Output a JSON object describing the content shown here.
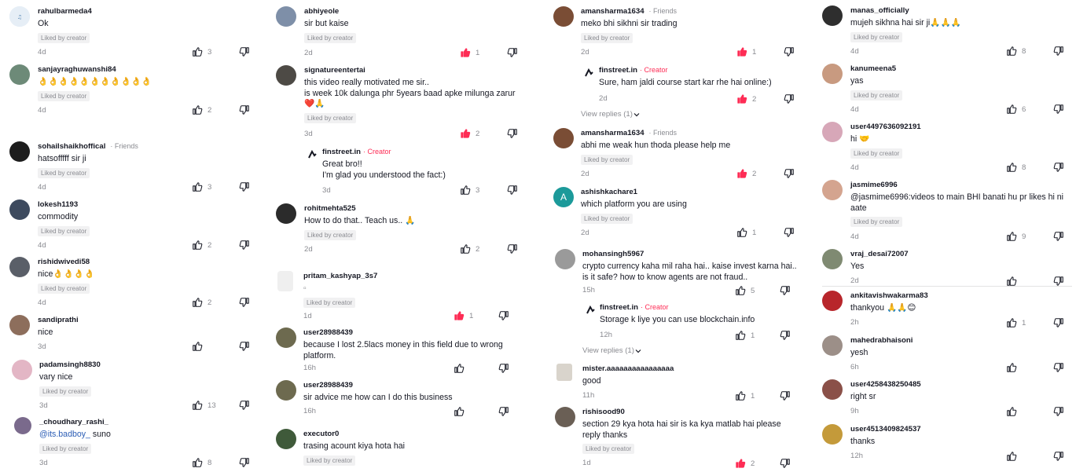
{
  "columns": [
    {
      "comments": [
        {
          "user": "rahulbarmeda4",
          "text": "Ok",
          "liked": "Liked by creator",
          "time": "4d",
          "likes": "3",
          "liked_by_me": false,
          "avatar_color": "#d8e4ef"
        },
        {
          "user": "sanjayraghuwanshi84",
          "text": "👌👌👌👌👌👌👌👌👌👌👌",
          "liked": "Liked by creator",
          "time": "4d",
          "likes": "2",
          "liked_by_me": false,
          "avatar_color": "#6d8a78"
        },
        {
          "user": "sohailshaikhoffical",
          "tag": "· Friends",
          "text": "hatsofffff sir ji",
          "liked": "Liked by creator",
          "time": "4d",
          "likes": "3",
          "liked_by_me": false,
          "avatar_color": "#1d1d1d"
        },
        {
          "user": "lokesh1193",
          "text": "commodity",
          "liked": "Liked by creator",
          "time": "4d",
          "likes": "2",
          "liked_by_me": false,
          "avatar_color": "#3d4a5e"
        },
        {
          "user": "rishidwivedi58",
          "text": "nice👌👌👌👌",
          "liked": "Liked by creator",
          "time": "4d",
          "likes": "2",
          "liked_by_me": false,
          "avatar_color": "#5a5f68"
        },
        {
          "user": "sandiprathi",
          "text": "nice",
          "time": "3d",
          "likes": "",
          "liked_by_me": false,
          "avatar_color": "#8d6e5c"
        },
        {
          "user": "padamsingh8830",
          "text": "vary nice",
          "liked": "Liked by creator",
          "time": "3d",
          "likes": "13",
          "liked_by_me": false,
          "avatar_color": "#e3b6c5"
        },
        {
          "user": "_choudhary_rashi_",
          "text": "@its.badboy_ suno",
          "mention": "@its.badboy_",
          "rest": " suno",
          "liked": "Liked by creator",
          "time": "3d",
          "likes": "8",
          "liked_by_me": false,
          "avatar_color": "#7a6a8c"
        }
      ]
    },
    {
      "comments": [
        {
          "user": "abhiyeole",
          "text": "sir but kaise",
          "liked": "Liked by creator",
          "time": "2d",
          "likes": "1",
          "liked_by_me": true,
          "avatar_color": "#7e8fa8"
        },
        {
          "user": "signatureentertai",
          "text": "this video really motivated me sir..\nis week 10k dalunga phr 5years baad apke milunga zarur\n❤️🙏",
          "liked": "Liked by creator",
          "time": "3d",
          "likes": "2",
          "liked_by_me": true,
          "avatar_color": "#4d4a45"
        },
        {
          "user": "finstreet.in",
          "tag": "· Creator",
          "text": "Great bro!!\nI'm glad you understood the fact:)",
          "time": "3d",
          "likes": "3",
          "liked_by_me": false,
          "avatar_color": "#ffffff"
        },
        {
          "user": "rohitmehta525",
          "text": "How to do that.. Teach us.. 🙏",
          "liked": "Liked by creator",
          "time": "2d",
          "likes": "2",
          "liked_by_me": false,
          "avatar_color": "#2b2b2b"
        },
        {
          "user": "pritam_kashyap_3s7",
          "text": "▫",
          "liked": "Liked by creator",
          "time": "1d",
          "likes": "1",
          "liked_by_me": true,
          "avatar_color": "#efefef"
        },
        {
          "user": "user28988439",
          "text": "because I lost 2.5lacs money in this field due to wrong platform.",
          "time": "16h",
          "likes": "",
          "liked_by_me": false,
          "avatar_color": "#6d6a4f"
        },
        {
          "user": "user28988439",
          "text": "sir advice me how can I do this business",
          "time": "16h",
          "likes": "",
          "liked_by_me": false,
          "avatar_color": "#6d6a4f"
        },
        {
          "user": "executor0",
          "text": "trasing acount kiya hota hai",
          "liked": "Liked by creator",
          "time": "",
          "likes": "",
          "liked_by_me": false,
          "avatar_color": "#3f5a3a"
        }
      ]
    },
    {
      "comments": [
        {
          "user": "amansharma1634",
          "tag": "· Friends",
          "text": "meko bhi sikhni sir trading",
          "liked": "Liked by creator",
          "time": "2d",
          "likes": "1",
          "liked_by_me": true,
          "avatar_color": "#7a4d35"
        },
        {
          "user": "finstreet.in",
          "tag": "· Creator",
          "text": "Sure, ham jaldi course start kar rhe hai online:)",
          "time": "2d",
          "likes": "2",
          "liked_by_me": true,
          "avatar_color": "#ffffff"
        },
        {
          "user": "amansharma1634",
          "tag": "· Friends",
          "text": "abhi me weak hun thoda please help me",
          "liked": "Liked by creator",
          "time": "2d",
          "likes": "2",
          "liked_by_me": true,
          "avatar_color": "#7a4d35"
        },
        {
          "user": "ashishkachare1",
          "text": "which platform you are using",
          "liked": "Liked by creator",
          "time": "2d",
          "likes": "1",
          "liked_by_me": false,
          "avatar_color": "#1c9a9a",
          "initial": "A"
        },
        {
          "user": "mohansingh5967",
          "text": "crypto currency kaha mil raha hai.. kaise invest karna hai..\nis it safe? how to know agents are not fraud..",
          "time": "15h",
          "likes": "5",
          "liked_by_me": false,
          "avatar_color": "#9a9a9a"
        },
        {
          "user": "finstreet.in",
          "tag": "· Creator",
          "text": "Storage k liye you can use blockchain.info",
          "time": "12h",
          "likes": "1",
          "liked_by_me": false,
          "avatar_color": "#ffffff"
        },
        {
          "user": "mister.aaaaaaaaaaaaaaaa",
          "text": "good",
          "time": "11h",
          "likes": "1",
          "liked_by_me": false,
          "avatar_color": "#d9d4cc"
        },
        {
          "user": "rishisood90",
          "text": "section 29 kya hota hai sir is ka kya matlab hai please reply thanks",
          "liked": "Liked by creator",
          "time": "1d",
          "likes": "2",
          "liked_by_me": true,
          "avatar_color": "#6a5f55"
        }
      ],
      "view_replies": [
        "View replies (1)",
        "View replies (1)"
      ]
    },
    {
      "comments": [
        {
          "user": "manas_officially",
          "text": "mujeh sikhna hai sir ji🙏🙏🙏",
          "liked": "Liked by creator",
          "time": "4d",
          "likes": "8",
          "liked_by_me": false,
          "avatar_color": "#2e2e2e"
        },
        {
          "user": "kanumeena5",
          "text": "yas",
          "liked": "Liked by creator",
          "time": "4d",
          "likes": "6",
          "liked_by_me": false,
          "avatar_color": "#c89a80"
        },
        {
          "user": "user4497636092191",
          "text": "hi 🤝",
          "liked": "Liked by creator",
          "time": "4d",
          "likes": "8",
          "liked_by_me": false,
          "avatar_color": "#d7a7b8"
        },
        {
          "user": "jasmime6996",
          "text": "@jasmime6996:videos to main BHI banati hu pr likes hi ni aate",
          "liked": "Liked by creator",
          "time": "4d",
          "likes": "9",
          "liked_by_me": false,
          "avatar_color": "#d4a48f"
        },
        {
          "user": "vraj_desai72007",
          "text": "Yes",
          "time": "2d",
          "likes": "",
          "liked_by_me": false,
          "avatar_color": "#7f8a72"
        },
        {
          "user": "ankitavishwakarma83",
          "text": "thankyou 🙏🙏😊",
          "time": "2h",
          "likes": "1",
          "liked_by_me": false,
          "avatar_color": "#b8262b"
        },
        {
          "user": "mahedrabhaisoni",
          "text": "yesh",
          "time": "6h",
          "likes": "",
          "liked_by_me": false,
          "avatar_color": "#9c8f88"
        },
        {
          "user": "user4258438250485",
          "text": "right sr",
          "time": "9h",
          "likes": "",
          "liked_by_me": false,
          "avatar_color": "#8a5048"
        },
        {
          "user": "user4513409824537",
          "text": "thanks",
          "time": "12h",
          "likes": "",
          "liked_by_me": false,
          "avatar_color": "#c49a3a"
        }
      ]
    }
  ],
  "colors": {
    "accent": "#fe2c55",
    "muted": "#8a8b91",
    "text": "#161823",
    "tag_bg": "#f1f1f2"
  },
  "icons": {
    "like": "thumbs-up-icon",
    "dislike": "thumbs-down-icon",
    "chevron": "chevron-down-icon"
  }
}
